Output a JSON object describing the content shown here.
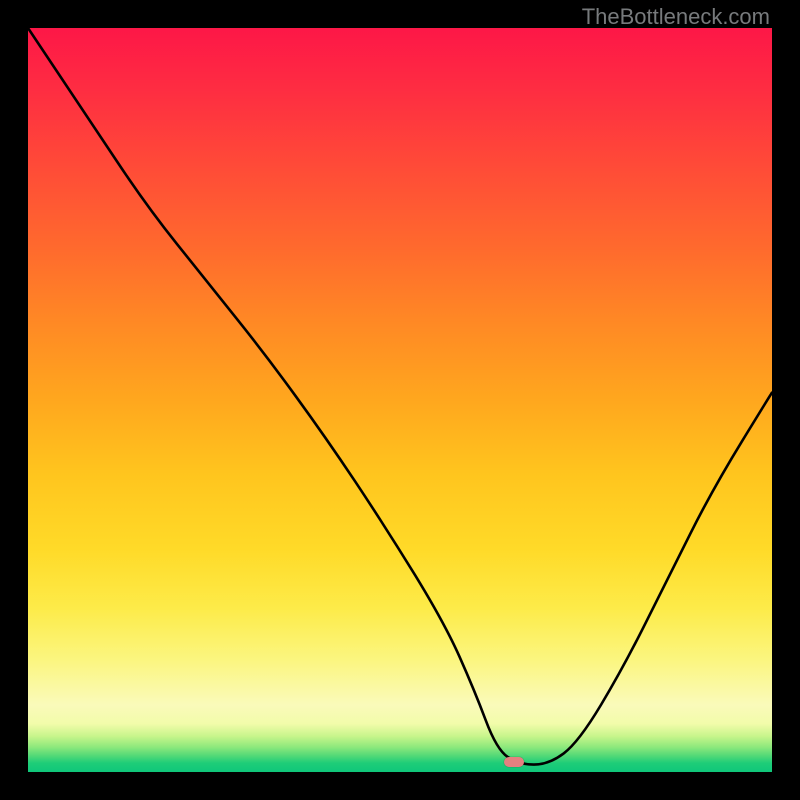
{
  "watermark": "TheBottleneck.com",
  "marker": {
    "x_frac": 0.653,
    "y_frac": 0.987
  },
  "chart_data": {
    "type": "line",
    "title": "",
    "xlabel": "",
    "ylabel": "",
    "xlim": [
      0,
      100
    ],
    "ylim": [
      0,
      100
    ],
    "series": [
      {
        "name": "bottleneck-curve",
        "x": [
          0,
          8,
          16,
          24,
          32,
          40,
          48,
          56,
          60,
          63,
          66,
          70,
          74,
          80,
          86,
          92,
          100
        ],
        "values": [
          100,
          88,
          76,
          66,
          56,
          45,
          33,
          20,
          11,
          3,
          1,
          1,
          4,
          14,
          26,
          38,
          51
        ]
      }
    ],
    "gradient_colors_top_to_bottom": [
      "#fd1747",
      "#ff6b2d",
      "#ffc51e",
      "#fafaba",
      "#0fc77a"
    ],
    "marker_value": {
      "x": 65,
      "y": 1
    }
  }
}
